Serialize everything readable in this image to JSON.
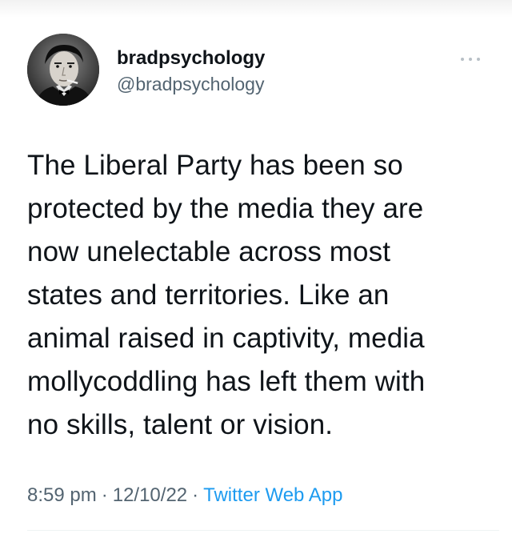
{
  "author": {
    "display_name": "bradpsychology",
    "handle": "@bradpsychology"
  },
  "tweet": {
    "text": "The Liberal Party has been so\nprotected by the media they are\nnow unelectable across most\nstates and territories.   Like an\nanimal raised in captivity, media\nmollycoddling has left them with\nno skills, talent or vision.",
    "time": "8:59 pm",
    "date": "12/10/22",
    "separator": "·",
    "source": "Twitter Web App"
  },
  "icons": {
    "avatar": "profile-photo",
    "more": "more-horizontal-icon"
  },
  "colors": {
    "text": "#0f1419",
    "secondary": "#536471",
    "link": "#1d9bf0"
  }
}
